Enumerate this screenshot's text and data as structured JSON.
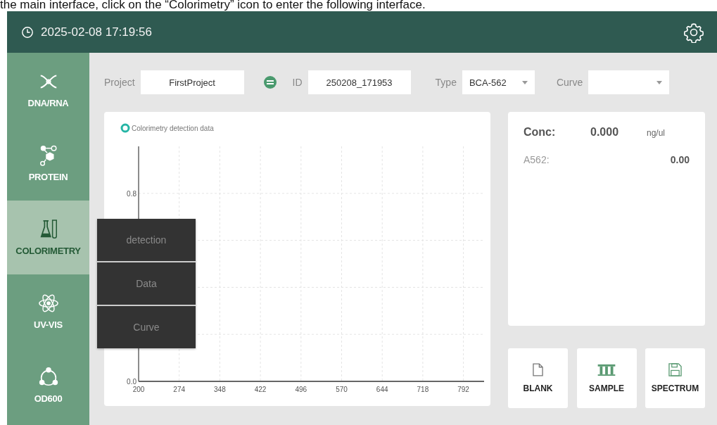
{
  "caption": "the main interface, click on the “Colorimetry” icon to enter the following interface.",
  "header": {
    "datetime": "2025-02-08 17:19:56"
  },
  "sidebar": {
    "items": [
      {
        "kind": "dna",
        "label": "DNA/RNA",
        "selected": false
      },
      {
        "kind": "molecule",
        "label": "PROTEIN",
        "selected": false
      },
      {
        "kind": "flask",
        "label": "COLORIMETRY",
        "selected": true
      },
      {
        "kind": "atom",
        "label": "UV-VIS",
        "selected": false
      },
      {
        "kind": "ring",
        "label": "OD600",
        "selected": false
      }
    ]
  },
  "popup_menu": {
    "items": [
      "detection",
      "Data",
      "Curve"
    ]
  },
  "toolbar": {
    "project_label": "Project",
    "project": "FirstProject",
    "id_label": "ID",
    "id": "250208_171953",
    "type_label": "Type",
    "type": "BCA-562",
    "curve_label": "Curve"
  },
  "chart": {
    "chart_data": {
      "type": "line",
      "series": [
        {
          "name": "Colorimetry detection data",
          "color": "#26b5a5",
          "values": [
            null,
            null,
            null,
            null,
            null,
            null,
            null,
            null,
            null
          ]
        }
      ],
      "categories": [
        "200",
        "274",
        "348",
        "422",
        "496",
        "570",
        "644",
        "718",
        "792"
      ],
      "ylim": [
        0,
        1
      ],
      "grid": true,
      "yticks": [
        {
          "value": 0,
          "label": "0.0"
        },
        {
          "value": 0.8,
          "label": "0.8"
        }
      ]
    }
  },
  "result": {
    "conc_label": "Conc:",
    "conc": "0.000",
    "conc_unit": "ng/ul",
    "abs_label": "A562:",
    "abs": "0.00"
  },
  "actions": [
    {
      "kind": "blank",
      "label": "BLANK"
    },
    {
      "kind": "sample",
      "label": "SAMPLE"
    },
    {
      "kind": "spectrum",
      "label": "SPECTRUM"
    }
  ]
}
